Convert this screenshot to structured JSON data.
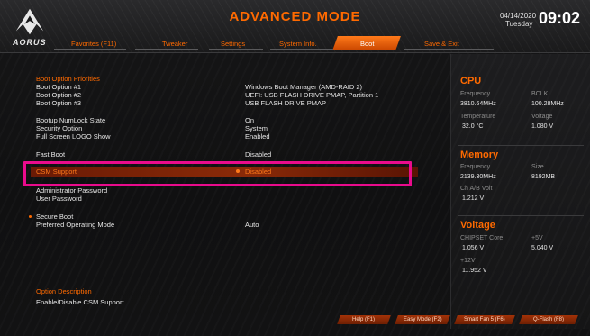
{
  "header": {
    "title": "ADVANCED MODE",
    "logo_text": "AORUS",
    "date": "04/14/2020",
    "day": "Tuesday",
    "time": "09:02"
  },
  "tabs": [
    {
      "label": "Favorites (F11)"
    },
    {
      "label": "Tweaker"
    },
    {
      "label": "Settings"
    },
    {
      "label": "System Info."
    },
    {
      "label": "Boot"
    },
    {
      "label": "Save & Exit"
    }
  ],
  "boot": {
    "priorities_heading": "Boot Option Priorities",
    "rows": [
      {
        "label": "Boot Option #1",
        "value": "Windows Boot Manager (AMD-RAID 2)"
      },
      {
        "label": "Boot Option #2",
        "value": "UEFI: USB FLASH DRIVE PMAP, Partition 1"
      },
      {
        "label": "Boot Option #3",
        "value": "USB FLASH DRIVE PMAP"
      },
      {
        "label": "Bootup NumLock State",
        "value": "On"
      },
      {
        "label": "Security Option",
        "value": "System"
      },
      {
        "label": "Full Screen LOGO Show",
        "value": "Enabled"
      },
      {
        "label": "Fast Boot",
        "value": "Disabled"
      },
      {
        "label": "CSM Support",
        "value": "Disabled"
      },
      {
        "label": "Administrator Password",
        "value": ""
      },
      {
        "label": "User Password",
        "value": ""
      },
      {
        "label": "Secure Boot",
        "value": ""
      },
      {
        "label": "Preferred Operating Mode",
        "value": "Auto"
      }
    ]
  },
  "description": {
    "title": "Option Description",
    "text": "Enable/Disable CSM Support."
  },
  "side": {
    "cpu": {
      "heading": "CPU",
      "freq_label": "Frequency",
      "freq_value": "3810.64MHz",
      "bclk_label": "BCLK",
      "bclk_value": "100.28MHz",
      "temp_label": "Temperature",
      "temp_value": "32.0 °C",
      "volt_label": "Voltage",
      "volt_value": "1.080 V"
    },
    "memory": {
      "heading": "Memory",
      "freq_label": "Frequency",
      "freq_value": "2139.30MHz",
      "size_label": "Size",
      "size_value": "8192MB",
      "chab_label": "Ch A/B Volt",
      "chab_value": "1.212 V"
    },
    "voltage": {
      "heading": "Voltage",
      "chipset_label": "CHIPSET Core",
      "chipset_value": "1.056 V",
      "v5_label": "+5V",
      "v5_value": "5.040 V",
      "v12_label": "+12V",
      "v12_value": "11.952 V"
    }
  },
  "buttons": [
    {
      "label": "Help (F1)"
    },
    {
      "label": "Easy Mode (F2)"
    },
    {
      "label": "Smart Fan 5 (F6)"
    },
    {
      "label": "Q-Flash (F8)"
    }
  ],
  "colors": {
    "accent": "#ff6a00",
    "highlight_box": "#ea0b8c",
    "selected_row": "#8a2a08"
  },
  "icons": {
    "logo": "aorus-eagle-icon"
  }
}
